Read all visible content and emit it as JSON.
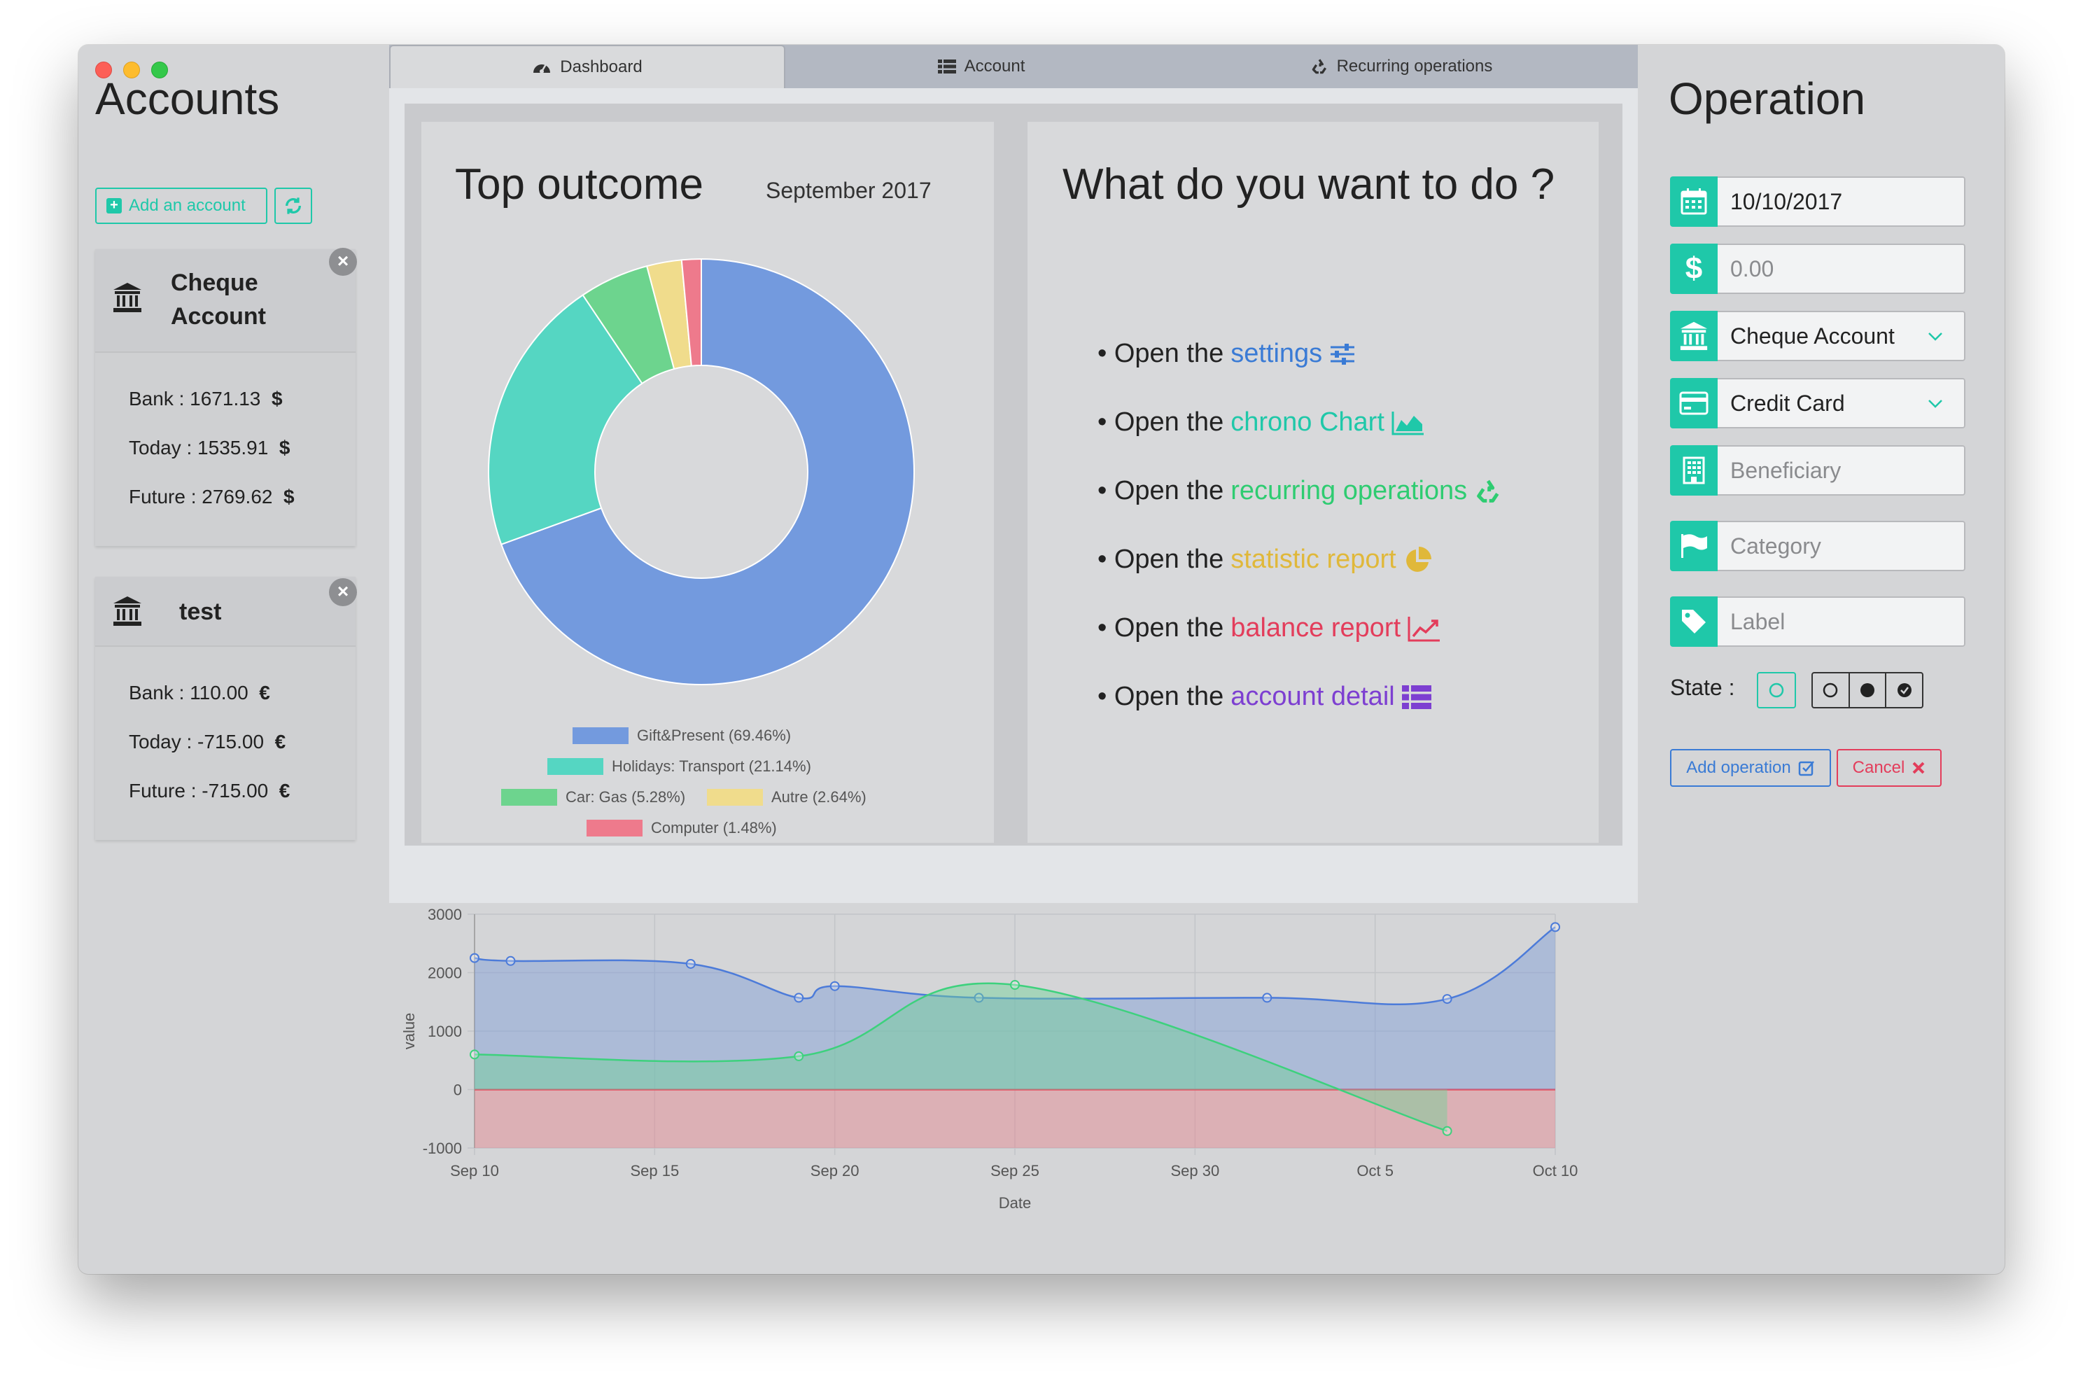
{
  "window": {
    "controls": [
      "close",
      "minimize",
      "zoom"
    ]
  },
  "sidebar": {
    "title": "Accounts",
    "add_account_label": "Add an account",
    "accounts": [
      {
        "name": "Cheque Account",
        "bank": "Bank : 1671.13",
        "today": "Today : 1535.91",
        "future": "Future : 2769.62",
        "currency": "$"
      },
      {
        "name": "test",
        "bank": "Bank : 110.00",
        "today": "Today : -715.00",
        "future": "Future : -715.00",
        "currency": "€"
      }
    ]
  },
  "tabs": [
    {
      "label": "Dashboard",
      "icon": "dashboard-icon",
      "active": true
    },
    {
      "label": "Account",
      "icon": "list-icon",
      "active": false
    },
    {
      "label": "Recurring operations",
      "icon": "recycle-icon",
      "active": false
    }
  ],
  "top_outcome": {
    "title": "Top outcome",
    "period": "September 2017"
  },
  "todo": {
    "title": "What do you want to do ?",
    "items": [
      {
        "prefix": "• Open the",
        "link": "settings",
        "color": "#3a7bd5",
        "icon": "sliders-icon"
      },
      {
        "prefix": "• Open the",
        "link": "chrono Chart",
        "color": "#1fc8a9",
        "icon": "area-chart-icon"
      },
      {
        "prefix": "• Open the",
        "link": "recurring operations",
        "color": "#2ecc71",
        "icon": "recycle-icon"
      },
      {
        "prefix": "• Open the",
        "link": "statistic report",
        "color": "#e0b83a",
        "icon": "pie-chart-icon"
      },
      {
        "prefix": "• Open the",
        "link": "balance report",
        "color": "#e33d5b",
        "icon": "line-chart-icon"
      },
      {
        "prefix": "• Open the",
        "link": "account detail",
        "color": "#7d3fd1",
        "icon": "list-icon"
      }
    ]
  },
  "operation": {
    "title": "Operation",
    "date": "10/10/2017",
    "amount_placeholder": "0.00",
    "account": "Cheque Account",
    "payment": "Credit Card",
    "beneficiary_placeholder": "Beneficiary",
    "category_placeholder": "Category",
    "label_placeholder": "Label",
    "state_label": "State :",
    "add_label": "Add operation",
    "cancel_label": "Cancel"
  },
  "colors": {
    "accent": "#1fc8a9",
    "primary": "#3a7bd5",
    "danger": "#e33d5b"
  },
  "chart_data": [
    {
      "type": "pie",
      "title": "",
      "labels": [
        "Gift&Present (69.46%)",
        "Holidays: Transport (21.14%)",
        "Car: Gas (5.28%)",
        "Autre (2.64%)",
        "Computer (1.48%)"
      ],
      "values": [
        69.46,
        21.14,
        5.28,
        2.64,
        1.48
      ],
      "colors": [
        "#739ade",
        "#55d6c2",
        "#6dd48e",
        "#f0dc8c",
        "#ee7a8c"
      ],
      "legend": "bottom"
    },
    {
      "type": "area",
      "xlabel": "Date",
      "ylabel": "value",
      "ylim": [
        -1000,
        3000
      ],
      "yticks": [
        3000,
        2000,
        1000,
        0,
        -1000
      ],
      "xticks": [
        "Sep 10",
        "Sep 15",
        "Sep 20",
        "Sep 25",
        "Sep 30",
        "Oct 5",
        "Oct 10"
      ],
      "xlim": [
        "2017-09-10",
        "2017-10-10"
      ],
      "series": [
        {
          "color": "#4c7bd9",
          "fill": "rgba(124,155,215,0.45)",
          "points": [
            [
              "2017-09-10",
              2250
            ],
            [
              "2017-09-11",
              2200
            ],
            [
              "2017-09-16",
              2150
            ],
            [
              "2017-09-19",
              1570
            ],
            [
              "2017-09-20",
              1770
            ],
            [
              "2017-09-24",
              1570
            ],
            [
              "2017-10-02",
              1570
            ],
            [
              "2017-10-07",
              1550
            ],
            [
              "2017-10-10",
              2780
            ]
          ]
        },
        {
          "color": "#3dd17d",
          "fill": "rgba(110,210,150,0.45)",
          "points": [
            [
              "2017-09-10",
              600
            ],
            [
              "2017-09-19",
              570
            ],
            [
              "2017-09-25",
              1790
            ],
            [
              "2017-10-07",
              -710
            ]
          ]
        },
        {
          "color": "#e74c5c",
          "fill": "rgba(230,130,140,0.45)",
          "points": [
            [
              "2017-09-10",
              0
            ],
            [
              "2017-10-10",
              0
            ]
          ]
        }
      ]
    }
  ]
}
